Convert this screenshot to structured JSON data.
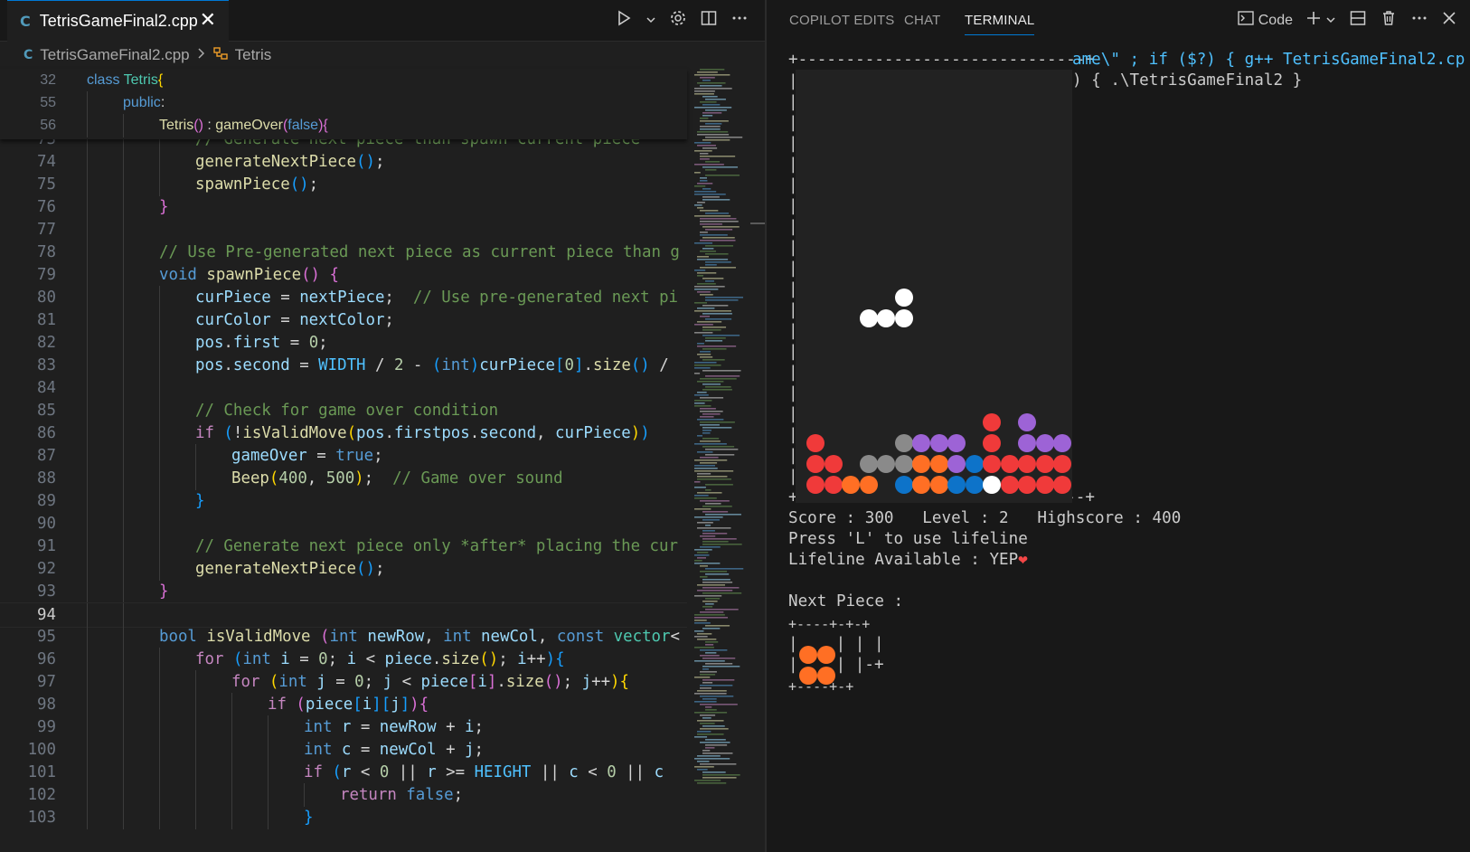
{
  "editor": {
    "tab_name": "TetrisGameFinal2.cpp",
    "tab_icon": "C",
    "close_glyph": "✕",
    "breadcrumb": {
      "file": "TetrisGameFinal2.cpp",
      "symbol": "Tetris"
    }
  },
  "sticky_lines": [
    {
      "n": "32",
      "tokens": [
        [
          "k",
          "class "
        ],
        [
          "t",
          "Tetris"
        ],
        [
          "p1",
          "{"
        ]
      ],
      "guides": 0
    },
    {
      "n": "55",
      "tokens": [
        [
          "k",
          "public"
        ],
        [
          "",
          ":"
        ]
      ],
      "guides": 1
    },
    {
      "n": "56",
      "tokens": [
        [
          "f",
          "Tetris"
        ],
        [
          "p2",
          "()"
        ],
        [
          "",
          " : "
        ],
        [
          "f",
          "gameOver"
        ],
        [
          "p2",
          "("
        ],
        [
          "k",
          "false"
        ],
        [
          "p2",
          ")"
        ],
        [
          "p2",
          "{"
        ]
      ],
      "guides": 2
    }
  ],
  "code_lines": [
    {
      "n": "73",
      "tokens": [
        [
          "m",
          "// Generate next piece than spawn current piece"
        ]
      ],
      "guides": 3
    },
    {
      "n": "74",
      "tokens": [
        [
          "f",
          "generateNextPiece"
        ],
        [
          "p3",
          "()"
        ],
        [
          "",
          ";"
        ]
      ],
      "guides": 3
    },
    {
      "n": "75",
      "tokens": [
        [
          "f",
          "spawnPiece"
        ],
        [
          "p3",
          "()"
        ],
        [
          "",
          ";"
        ]
      ],
      "guides": 3
    },
    {
      "n": "76",
      "tokens": [
        [
          "p2",
          "}"
        ]
      ],
      "guides": 2
    },
    {
      "n": "77",
      "tokens": [],
      "guides": 2
    },
    {
      "n": "78",
      "tokens": [
        [
          "m",
          "// Use Pre-generated next piece as current piece than g"
        ]
      ],
      "guides": 2
    },
    {
      "n": "79",
      "tokens": [
        [
          "k",
          "void "
        ],
        [
          "f",
          "spawnPiece"
        ],
        [
          "p2",
          "()"
        ],
        [
          "",
          " "
        ],
        [
          "p2",
          "{"
        ]
      ],
      "guides": 2
    },
    {
      "n": "80",
      "tokens": [
        [
          "v",
          "curPiece"
        ],
        [
          "",
          " = "
        ],
        [
          "v",
          "nextPiece"
        ],
        [
          "",
          ";  "
        ],
        [
          "m",
          "// Use pre-generated next pi"
        ]
      ],
      "guides": 3
    },
    {
      "n": "81",
      "tokens": [
        [
          "v",
          "curColor"
        ],
        [
          "",
          " = "
        ],
        [
          "v",
          "nextColor"
        ],
        [
          "",
          ";"
        ]
      ],
      "guides": 3
    },
    {
      "n": "82",
      "tokens": [
        [
          "v",
          "pos"
        ],
        [
          "",
          "."
        ],
        [
          "v",
          "first"
        ],
        [
          "",
          " = "
        ],
        [
          "n",
          "0"
        ],
        [
          "",
          ";"
        ]
      ],
      "guides": 3
    },
    {
      "n": "83",
      "tokens": [
        [
          "v",
          "pos"
        ],
        [
          "",
          "."
        ],
        [
          "v",
          "second"
        ],
        [
          "",
          " = "
        ],
        [
          "cn",
          "WIDTH"
        ],
        [
          "",
          " / "
        ],
        [
          "n",
          "2"
        ],
        [
          "",
          " - "
        ],
        [
          "p3",
          "("
        ],
        [
          "k",
          "int"
        ],
        [
          "p3",
          ")"
        ],
        [
          "v",
          "curPiece"
        ],
        [
          "p3",
          "["
        ],
        [
          "n",
          "0"
        ],
        [
          "p3",
          "]"
        ],
        [
          "",
          "."
        ],
        [
          "f",
          "size"
        ],
        [
          "p3",
          "()"
        ],
        [
          "",
          " /"
        ]
      ],
      "guides": 3
    },
    {
      "n": "84",
      "tokens": [],
      "guides": 3
    },
    {
      "n": "85",
      "tokens": [
        [
          "m",
          "// Check for game over condition"
        ]
      ],
      "guides": 3
    },
    {
      "n": "86",
      "tokens": [
        [
          "c",
          "if "
        ],
        [
          "p3",
          "("
        ],
        [
          "",
          "!"
        ],
        [
          "f",
          "isValidMove"
        ],
        [
          "p1",
          "("
        ],
        [
          "v",
          "pos"
        ],
        [
          "",
          "."
        ],
        [
          "v",
          "first"
        ],
        [
          ", "
        ],
        [
          "v",
          "pos"
        ],
        [
          "",
          "."
        ],
        [
          "v",
          "second"
        ],
        [
          "",
          ", "
        ],
        [
          "v",
          "curPiece"
        ],
        [
          "p1",
          ")"
        ],
        [
          "p3",
          ")"
        ]
      ],
      "guides": 3
    },
    {
      "n": "87",
      "tokens": [
        [
          "v",
          "gameOver"
        ],
        [
          "",
          " = "
        ],
        [
          "k",
          "true"
        ],
        [
          "",
          ";"
        ]
      ],
      "guides": 4
    },
    {
      "n": "88",
      "tokens": [
        [
          "f",
          "Beep"
        ],
        [
          "p1",
          "("
        ],
        [
          "n",
          "400"
        ],
        [
          "",
          ", "
        ],
        [
          "n",
          "500"
        ],
        [
          "p1",
          ")"
        ],
        [
          "",
          ";  "
        ],
        [
          "m",
          "// Game over sound"
        ]
      ],
      "guides": 4
    },
    {
      "n": "89",
      "tokens": [
        [
          "p3",
          "}"
        ]
      ],
      "guides": 3
    },
    {
      "n": "90",
      "tokens": [],
      "guides": 3
    },
    {
      "n": "91",
      "tokens": [
        [
          "m",
          "// Generate next piece only *after* placing the cur"
        ]
      ],
      "guides": 3
    },
    {
      "n": "92",
      "tokens": [
        [
          "f",
          "generateNextPiece"
        ],
        [
          "p3",
          "()"
        ],
        [
          "",
          ";"
        ]
      ],
      "guides": 3
    },
    {
      "n": "93",
      "tokens": [
        [
          "p2",
          "}"
        ]
      ],
      "guides": 2
    },
    {
      "n": "94",
      "tokens": [],
      "guides": 2,
      "current": true
    },
    {
      "n": "95",
      "tokens": [
        [
          "k",
          "bool "
        ],
        [
          "f",
          "isValidMove "
        ],
        [
          "p2",
          "("
        ],
        [
          "k",
          "int "
        ],
        [
          "v",
          "newRow"
        ],
        [
          "",
          ", "
        ],
        [
          "k",
          "int "
        ],
        [
          "v",
          "newCol"
        ],
        [
          "",
          ", "
        ],
        [
          "k",
          "const "
        ],
        [
          "t",
          "vector"
        ],
        [
          "",
          "<"
        ]
      ],
      "guides": 2
    },
    {
      "n": "96",
      "tokens": [
        [
          "c",
          "for "
        ],
        [
          "p3",
          "("
        ],
        [
          "k",
          "int "
        ],
        [
          "v",
          "i"
        ],
        [
          "",
          " = "
        ],
        [
          "n",
          "0"
        ],
        [
          "",
          "; "
        ],
        [
          "v",
          "i"
        ],
        [
          "",
          " < "
        ],
        [
          "v",
          "piece"
        ],
        [
          "",
          "."
        ],
        [
          "f",
          "size"
        ],
        [
          "p1",
          "()"
        ],
        [
          "",
          "; "
        ],
        [
          "v",
          "i"
        ],
        [
          "",
          "++"
        ],
        [
          "p3",
          ")"
        ],
        [
          "p3",
          "{"
        ]
      ],
      "guides": 3
    },
    {
      "n": "97",
      "tokens": [
        [
          "c",
          "for "
        ],
        [
          "p1",
          "("
        ],
        [
          "k",
          "int "
        ],
        [
          "v",
          "j"
        ],
        [
          "",
          " = "
        ],
        [
          "n",
          "0"
        ],
        [
          "",
          "; "
        ],
        [
          "v",
          "j"
        ],
        [
          "",
          " < "
        ],
        [
          "v",
          "piece"
        ],
        [
          "p2",
          "["
        ],
        [
          "v",
          "i"
        ],
        [
          "p2",
          "]"
        ],
        [
          "",
          "."
        ],
        [
          "f",
          "size"
        ],
        [
          "p2",
          "()"
        ],
        [
          "",
          "; "
        ],
        [
          "v",
          "j"
        ],
        [
          "",
          "++"
        ],
        [
          "p1",
          ")"
        ],
        [
          "p1",
          "{"
        ]
      ],
      "guides": 4
    },
    {
      "n": "98",
      "tokens": [
        [
          "c",
          "if "
        ],
        [
          "p2",
          "("
        ],
        [
          "v",
          "piece"
        ],
        [
          "p3",
          "["
        ],
        [
          "v",
          "i"
        ],
        [
          "p3",
          "]"
        ],
        [
          "p3",
          "["
        ],
        [
          "v",
          "j"
        ],
        [
          "p3",
          "]"
        ],
        [
          "p2",
          ")"
        ],
        [
          "p2",
          "{"
        ]
      ],
      "guides": 5
    },
    {
      "n": "99",
      "tokens": [
        [
          "k",
          "int "
        ],
        [
          "v",
          "r"
        ],
        [
          "",
          " = "
        ],
        [
          "v",
          "newRow"
        ],
        [
          "",
          " + "
        ],
        [
          "v",
          "i"
        ],
        [
          "",
          ";"
        ]
      ],
      "guides": 6
    },
    {
      "n": "100",
      "tokens": [
        [
          "k",
          "int "
        ],
        [
          "v",
          "c"
        ],
        [
          "",
          " = "
        ],
        [
          "v",
          "newCol"
        ],
        [
          "",
          " + "
        ],
        [
          "v",
          "j"
        ],
        [
          "",
          ";"
        ]
      ],
      "guides": 6
    },
    {
      "n": "101",
      "tokens": [
        [
          "c",
          "if "
        ],
        [
          "p3",
          "("
        ],
        [
          "v",
          "r"
        ],
        [
          "",
          " < "
        ],
        [
          "n",
          "0"
        ],
        [
          "",
          " || "
        ],
        [
          "v",
          "r"
        ],
        [
          "",
          " >= "
        ],
        [
          "cn",
          "HEIGHT"
        ],
        [
          "",
          " || "
        ],
        [
          "v",
          "c"
        ],
        [
          "",
          " < "
        ],
        [
          "n",
          "0"
        ],
        [
          "",
          " || "
        ],
        [
          "v",
          "c"
        ]
      ],
      "guides": 6
    },
    {
      "n": "102",
      "tokens": [
        [
          "c",
          "return "
        ],
        [
          "k",
          "false"
        ],
        [
          "",
          ";"
        ]
      ],
      "guides": 7
    },
    {
      "n": "103",
      "tokens": [
        [
          "p3",
          "}"
        ]
      ],
      "guides": 6
    }
  ],
  "panel": {
    "tabs": [
      "COPILOT EDITS",
      "CHAT",
      "TERMINAL"
    ],
    "active_tab": "TERMINAL",
    "terminal_profile": "Code"
  },
  "terminal": {
    "border_top": "+------------------------------+",
    "cmd_line1": "ame\\\" ; if ($?) { g++ TetrisGameFinal2.cp",
    "cmd_line2": ") { .\\TetrisGameFinal2 }",
    "wall": "|",
    "border_bottom": "+------------------------------+",
    "score_line": "Score : 300   Level : 2   Highscore : 400",
    "lifeline_prompt": "Press 'L' to use lifeline",
    "lifeline_status": "Lifeline Available : YEP",
    "lifeline_heart": "❤",
    "next_piece_label": "Next Piece :",
    "next_top": "+----+-+-+",
    "next_row1_right": "| | |",
    "next_row2_right": "| |-+",
    "next_bottom": "+----+-+"
  },
  "game": {
    "score": 300,
    "level": 2,
    "highscore": 400,
    "colors": {
      "W": "#ffffff",
      "R": "#f03a3a",
      "O": "#ff6f24",
      "P": "#9d63d6",
      "G": "#8a8a8a",
      "B": "#0d73c9"
    },
    "active_piece": [
      [
        10,
        5,
        "W"
      ],
      [
        11,
        3,
        "W"
      ],
      [
        11,
        4,
        "W"
      ],
      [
        11,
        5,
        "W"
      ]
    ],
    "stack": [
      [
        16,
        10,
        "R"
      ],
      [
        16,
        12,
        "P"
      ],
      [
        17,
        0,
        "R"
      ],
      [
        17,
        5,
        "G"
      ],
      [
        17,
        6,
        "P"
      ],
      [
        17,
        7,
        "P"
      ],
      [
        17,
        8,
        "P"
      ],
      [
        17,
        10,
        "R"
      ],
      [
        17,
        12,
        "P"
      ],
      [
        17,
        13,
        "P"
      ],
      [
        17,
        14,
        "P"
      ],
      [
        18,
        0,
        "R"
      ],
      [
        18,
        1,
        "R"
      ],
      [
        18,
        3,
        "G"
      ],
      [
        18,
        4,
        "G"
      ],
      [
        18,
        5,
        "G"
      ],
      [
        18,
        6,
        "O"
      ],
      [
        18,
        7,
        "O"
      ],
      [
        18,
        8,
        "P"
      ],
      [
        18,
        9,
        "B"
      ],
      [
        18,
        10,
        "R"
      ],
      [
        18,
        11,
        "R"
      ],
      [
        18,
        12,
        "R"
      ],
      [
        18,
        13,
        "R"
      ],
      [
        18,
        14,
        "R"
      ],
      [
        19,
        0,
        "R"
      ],
      [
        19,
        1,
        "R"
      ],
      [
        19,
        2,
        "O"
      ],
      [
        19,
        3,
        "O"
      ],
      [
        19,
        5,
        "B"
      ],
      [
        19,
        6,
        "O"
      ],
      [
        19,
        7,
        "O"
      ],
      [
        19,
        8,
        "B"
      ],
      [
        19,
        9,
        "B"
      ],
      [
        19,
        10,
        "W"
      ],
      [
        19,
        11,
        "R"
      ],
      [
        19,
        12,
        "R"
      ],
      [
        19,
        13,
        "R"
      ],
      [
        19,
        14,
        "R"
      ]
    ],
    "next_piece": [
      [
        0,
        0,
        "O"
      ],
      [
        0,
        1,
        "O"
      ],
      [
        1,
        0,
        "O"
      ],
      [
        1,
        1,
        "O"
      ]
    ]
  }
}
